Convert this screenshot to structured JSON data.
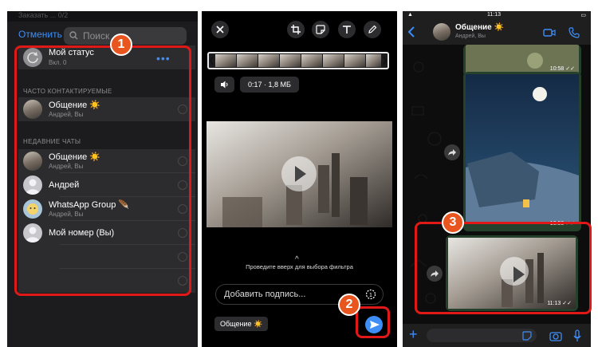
{
  "left_panel": {
    "top_hint": "Заказать ...   0/2",
    "cancel_label": "Отменить",
    "search_placeholder": "Поиск",
    "my_status": {
      "name": "Мой статус",
      "sub": "Вкл. 0",
      "more": "•••"
    },
    "frequent_header": "ЧАСТО КОНТАКТИРУЕМЫЕ",
    "frequent": [
      {
        "name": "Общение ☀️",
        "sub": "Андрей, Вы"
      }
    ],
    "recent_header": "НЕДАВНИЕ ЧАТЫ",
    "recent": [
      {
        "name": "Общение ☀️",
        "sub": "Андрей, Вы"
      },
      {
        "name": "Андрей",
        "sub": ""
      },
      {
        "name": "WhatsApp Group 🪶",
        "sub": "Андрей, Вы"
      },
      {
        "name": "Мой номер (Вы)",
        "sub": ""
      }
    ],
    "badge": "1"
  },
  "middle_panel": {
    "mute_icon": "speaker-icon",
    "duration_size": "0:17 · 1,8 МБ",
    "filter_hint": "Проведите вверх для выбора фильтра",
    "caption_placeholder": "Добавить подпись...",
    "recipient": "Общение ☀️",
    "badge": "2"
  },
  "right_panel": {
    "time": "11:13",
    "chat_title": "Общение ☀️",
    "chat_members": "Андрей, Вы",
    "ts1": "10:58 ✓✓",
    "ts2": "10:58 ✓✓",
    "ts3": "11:13 ✓✓",
    "badge": "3"
  },
  "colors": {
    "accent": "#3f8ef7",
    "highlight": "#e01818",
    "badge": "#e8551e",
    "bubble": "#25412c"
  }
}
